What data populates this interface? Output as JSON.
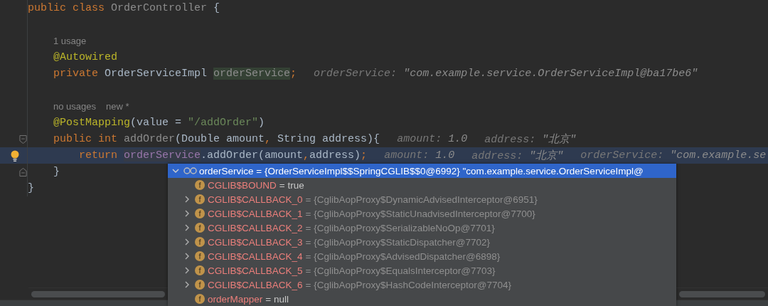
{
  "editor": {
    "lines": [
      {
        "kind": "code",
        "current": false,
        "tokens": [
          {
            "kind": "kw",
            "text": "public class "
          },
          {
            "kind": "unused",
            "text": "OrderController"
          },
          {
            "kind": "plain",
            "text": " {"
          }
        ],
        "children": [
          {
            "kind": "blank",
            "current": false
          },
          {
            "kind": "usage",
            "current": false,
            "texts": [
              "1 usage"
            ]
          },
          {
            "kind": "code",
            "current": false,
            "tokens": [
              {
                "kind": "ann",
                "text": "@Autowired"
              }
            ]
          },
          {
            "kind": "code",
            "current": false,
            "tokens": [
              {
                "kind": "kw",
                "text": "private "
              },
              {
                "kind": "plain",
                "text": "OrderServiceImpl "
              },
              {
                "kind": "field-usage",
                "text": "orderService"
              },
              {
                "kind": "punct",
                "text": ";"
              }
            ],
            "hints": [
              {
                "label": "orderService:",
                "value": "\"com.example.service.OrderServiceImpl@ba17be6\""
              }
            ]
          },
          {
            "kind": "blank",
            "current": false
          },
          {
            "kind": "usage",
            "current": false,
            "texts": [
              "no usages",
              "new *"
            ]
          },
          {
            "kind": "code",
            "current": false,
            "tokens": [
              {
                "kind": "ann",
                "text": "@PostMapping"
              },
              {
                "kind": "plain",
                "text": "(value = "
              },
              {
                "kind": "str",
                "text": "\"/addOrder\""
              },
              {
                "kind": "plain",
                "text": ")"
              }
            ]
          },
          {
            "kind": "code",
            "current": false,
            "gutter_icon": {
              "kind": "fold-start"
            },
            "tokens": [
              {
                "kind": "kw",
                "text": "public int "
              },
              {
                "kind": "unused",
                "text": "addOrder"
              },
              {
                "kind": "plain",
                "text": "(Double amount"
              },
              {
                "kind": "punct",
                "text": ", "
              },
              {
                "kind": "plain",
                "text": "String address){"
              }
            ],
            "hints": [
              {
                "label": "amount:",
                "value": "1.0"
              },
              {
                "label": "address:",
                "value": "\"北京\""
              }
            ],
            "children": [
              {
                "kind": "code",
                "current": true,
                "gutter_icon": {
                  "kind": "bulb"
                },
                "tokens": [
                  {
                    "kind": "kw",
                    "text": "return "
                  },
                  {
                    "kind": "field-hovered",
                    "text": "orderService"
                  },
                  {
                    "kind": "plain",
                    "text": ".addOrder(amount"
                  },
                  {
                    "kind": "punct",
                    "text": ","
                  },
                  {
                    "kind": "plain",
                    "text": "address)"
                  },
                  {
                    "kind": "punct",
                    "text": ";"
                  }
                ],
                "hints": [
                  {
                    "label": "amount:",
                    "value": "1.0"
                  },
                  {
                    "label": "address:",
                    "value": "\"北京\""
                  },
                  {
                    "label": "orderService:",
                    "value": "\"com.example.se"
                  }
                ]
              }
            ]
          },
          {
            "kind": "code",
            "current": false,
            "gutter_icon": {
              "kind": "fold-end"
            },
            "tokens": [
              {
                "kind": "plain",
                "text": "}"
              }
            ]
          }
        ]
      },
      {
        "kind": "code",
        "current": false,
        "tokens": [
          {
            "kind": "plain",
            "text": "}"
          }
        ]
      }
    ]
  },
  "debug_popup": {
    "header": {
      "expanded": true,
      "selected": true,
      "text": "orderService = {OrderServiceImpl$$SpringCGLIB$$0@6992} \"com.example.service.OrderServiceImpl@"
    },
    "rows": [
      {
        "badge": "f",
        "name": "CGLIB$BOUND",
        "value": "= true",
        "kind": "primitive",
        "expandable": false,
        "selected": false
      },
      {
        "badge": "f",
        "name": "CGLIB$CALLBACK_0",
        "value": "= {CglibAopProxy$DynamicAdvisedInterceptor@6951}",
        "kind": "object",
        "expandable": true,
        "selected": false
      },
      {
        "badge": "f",
        "name": "CGLIB$CALLBACK_1",
        "value": "= {CglibAopProxy$StaticUnadvisedInterceptor@7700}",
        "kind": "object",
        "expandable": true,
        "selected": false
      },
      {
        "badge": "f",
        "name": "CGLIB$CALLBACK_2",
        "value": "= {CglibAopProxy$SerializableNoOp@7701}",
        "kind": "object",
        "expandable": true,
        "selected": false
      },
      {
        "badge": "f",
        "name": "CGLIB$CALLBACK_3",
        "value": "= {CglibAopProxy$StaticDispatcher@7702}",
        "kind": "object",
        "expandable": true,
        "selected": false
      },
      {
        "badge": "f",
        "name": "CGLIB$CALLBACK_4",
        "value": "= {CglibAopProxy$AdvisedDispatcher@6898}",
        "kind": "object",
        "expandable": true,
        "selected": false
      },
      {
        "badge": "f",
        "name": "CGLIB$CALLBACK_5",
        "value": "= {CglibAopProxy$EqualsInterceptor@7703}",
        "kind": "object",
        "expandable": true,
        "selected": false
      },
      {
        "badge": "f",
        "name": "CGLIB$CALLBACK_6",
        "value": "= {CglibAopProxy$HashCodeInterceptor@7704}",
        "kind": "object",
        "expandable": true,
        "selected": false
      },
      {
        "badge": "f",
        "name": "orderMapper",
        "value": "= null",
        "kind": "primitive",
        "expandable": false,
        "selected": false
      }
    ]
  }
}
